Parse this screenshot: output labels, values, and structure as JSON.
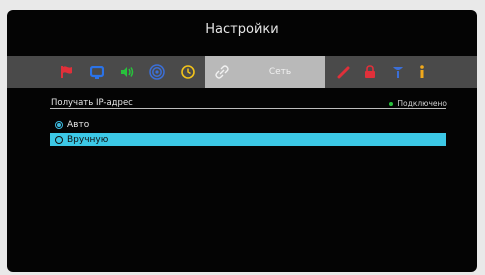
{
  "title": "Настройки",
  "tabs": [
    {
      "name": "flag-icon",
      "color": "#e0303a"
    },
    {
      "name": "monitor-icon",
      "color": "#2b73e8"
    },
    {
      "name": "speaker-icon",
      "color": "#28c23c"
    },
    {
      "name": "wireless-icon",
      "color": "#3b6fd8"
    },
    {
      "name": "clock-icon",
      "color": "#f1c21b"
    },
    {
      "name": "network-icon",
      "label": "Сеть",
      "selected": true
    },
    {
      "name": "pencil-icon",
      "color": "#e0303a"
    },
    {
      "name": "lock-icon",
      "color": "#e0303a"
    },
    {
      "name": "antenna-icon",
      "color": "#3b6fd8"
    },
    {
      "name": "info-icon",
      "color": "#f1a91b"
    }
  ],
  "ip": {
    "label": "Получать IP-адрес",
    "status": "Подключено",
    "status_color": "#28c23c",
    "options": [
      {
        "label": "Авто",
        "checked": true
      },
      {
        "label": "Вручную",
        "checked": false,
        "highlighted": true
      }
    ]
  },
  "colors": {
    "highlight": "#3cc8e6",
    "tabbar": "#4a4a4a",
    "selected_tab": "#b9b9b9"
  }
}
